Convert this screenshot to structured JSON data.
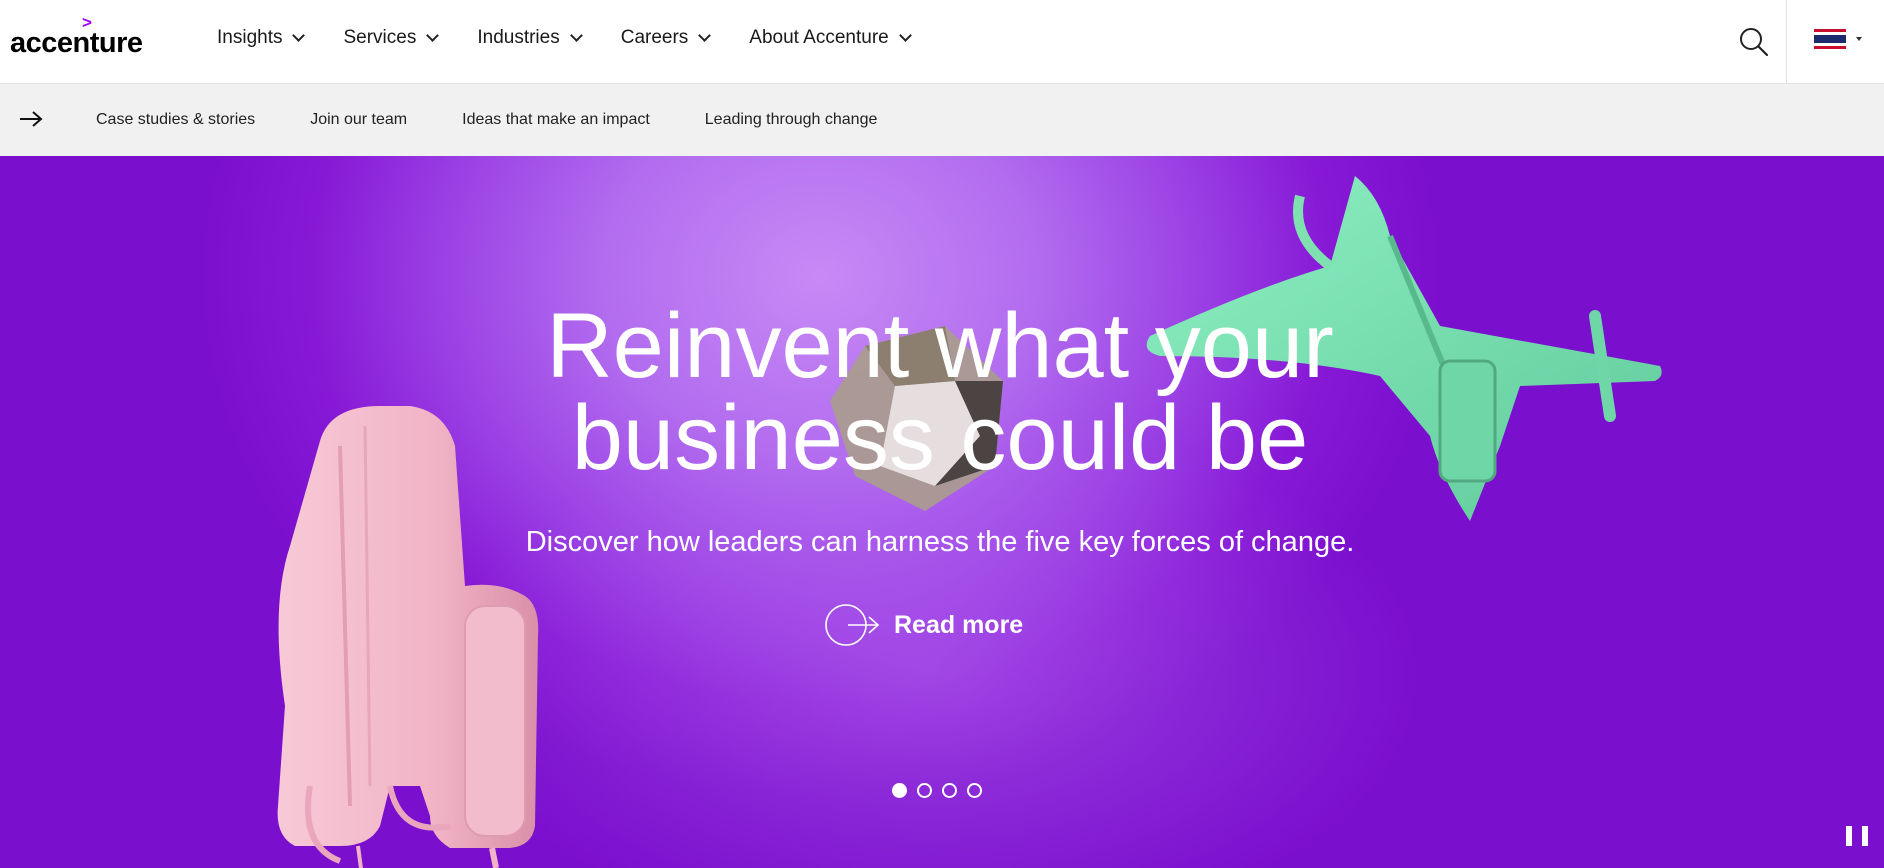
{
  "brand": {
    "logo_text": "accenture",
    "logo_mark": ">",
    "accent_color": "#a100ff"
  },
  "nav": {
    "items": [
      {
        "label": "Insights"
      },
      {
        "label": "Services"
      },
      {
        "label": "Industries"
      },
      {
        "label": "Careers"
      },
      {
        "label": "About Accenture"
      }
    ],
    "search_icon": "search-icon",
    "country_flag": "thailand-flag-icon"
  },
  "subnav": {
    "arrow_icon": "arrow-right-icon",
    "links": [
      {
        "label": "Case studies & stories"
      },
      {
        "label": "Join our team"
      },
      {
        "label": "Ideas that make an impact"
      },
      {
        "label": "Leading through change"
      }
    ]
  },
  "hero": {
    "title_line1": "Reinvent what your",
    "title_line2": "business could be",
    "subtitle": "Discover how leaders can harness the five key forces of change.",
    "cta_label": "Read more",
    "cta_icon": "circle-arrow-icon",
    "slides_total": 4,
    "active_slide": 1,
    "pause_icon": "pause-icon",
    "colors": {
      "background": "#8a1fd8",
      "jetpack": "#f4b8cc",
      "plane": "#7fe0b0",
      "gem": "#bdb3a6"
    }
  }
}
